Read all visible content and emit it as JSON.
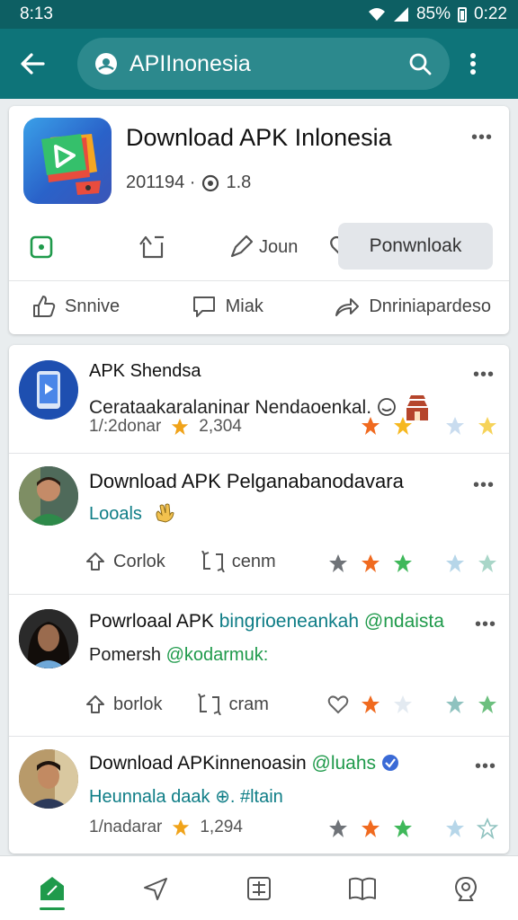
{
  "status": {
    "time_left": "8:13",
    "battery": "85%",
    "time_right": "0:22"
  },
  "search": {
    "query": "APIInonesia"
  },
  "app": {
    "title": "Download APK Inlonesia",
    "meta_date": "201194 ·",
    "meta_count": "1.8",
    "action_label": "Joun",
    "download_label": "Ponwnloak",
    "share_label": "Snnive",
    "message_label": "Miak",
    "forward_label": "Dnriniapardeso"
  },
  "posts": [
    {
      "title": "APK Shendsa",
      "subtitle": "Cerataakaralaninar Nendaoenkal.",
      "meta": "1/:2donar",
      "count": "2,304"
    },
    {
      "title": "Download APK Pelganabanodavara",
      "subtitle": "Looals",
      "like_label": "Corlok",
      "repost_label": "cenm"
    },
    {
      "title_plain": "Powrloaal APK ",
      "title_highlight": "bingrioeneankah",
      "title_tag": "@ndaista",
      "subtitle": "Pomersh ",
      "subtitle_tag": "@kodarmuk:",
      "like_label": "borlok",
      "repost_label": "cram"
    },
    {
      "title_plain": "Download APKinnenoasin ",
      "title_tag": "@luahs",
      "subtitle": "Heunnala daak ⊕. #ltain",
      "meta": "1/nadarar",
      "count": "1,294"
    }
  ],
  "colors": {
    "appbar": "#0e7479",
    "status": "#0d5f63",
    "accent": "#1f9a4b",
    "teal": "#0e7d86"
  }
}
